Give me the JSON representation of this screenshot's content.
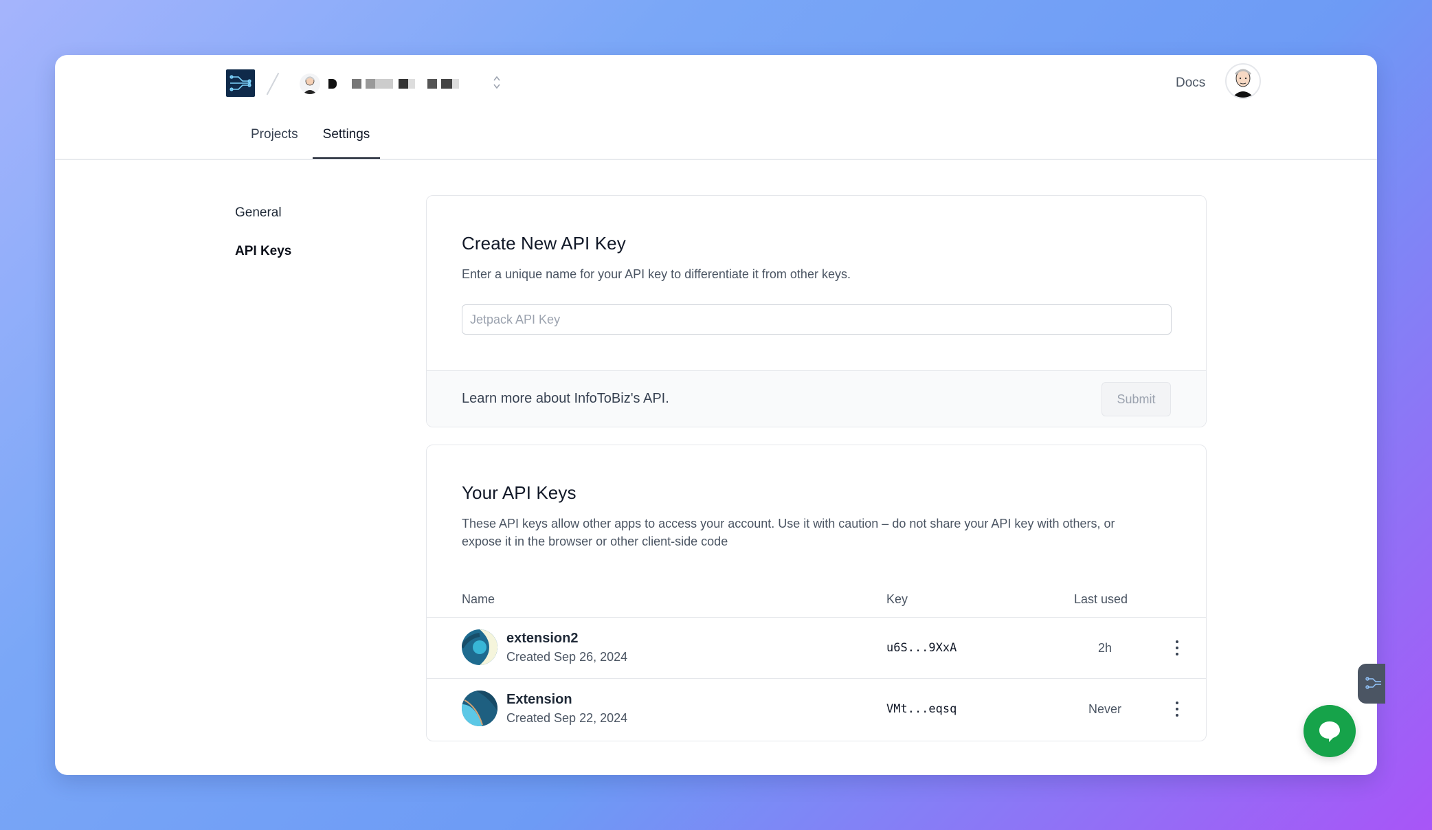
{
  "header": {
    "docs_label": "Docs",
    "tabs": [
      {
        "label": "Projects",
        "active": false
      },
      {
        "label": "Settings",
        "active": true
      }
    ]
  },
  "sidebar": {
    "items": [
      {
        "label": "General",
        "active": false
      },
      {
        "label": "API Keys",
        "active": true
      }
    ]
  },
  "create_card": {
    "title": "Create New API Key",
    "description": "Enter a unique name for your API key to differentiate it from other keys.",
    "input_placeholder": "Jetpack API Key",
    "input_value": "",
    "learn_more": "Learn more about InfoToBiz's API.",
    "submit_label": "Submit"
  },
  "keys_card": {
    "title": "Your API Keys",
    "description": "These API keys allow other apps to access your account. Use it with caution – do not share your API key with others, or expose it in the browser or other client-side code",
    "columns": {
      "name": "Name",
      "key": "Key",
      "last_used": "Last used"
    },
    "rows": [
      {
        "name": "extension2",
        "created": "Created Sep 26, 2024",
        "key": "u6S...9XxA",
        "last_used": "2h"
      },
      {
        "name": "Extension",
        "created": "Created Sep 22, 2024",
        "key": "VMt...eqsq",
        "last_used": "Never"
      }
    ]
  },
  "icons": {
    "logo": "circuit-logo-icon",
    "chevron": "chevron-up-down-icon",
    "row_menu": "more-vertical-icon",
    "chat": "chat-bubble-icon"
  },
  "colors": {
    "brand_dark": "#0f2a4a",
    "chat_green": "#16a34a",
    "accent_tab": "#111827"
  }
}
